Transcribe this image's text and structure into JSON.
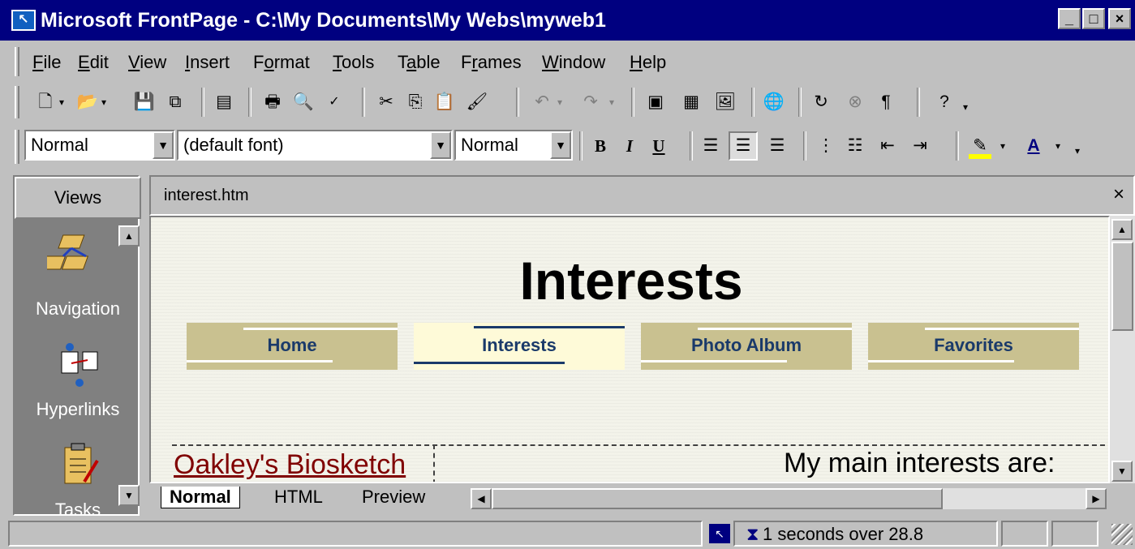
{
  "window": {
    "title": "Microsoft FrontPage - C:\\My Documents\\My Webs\\myweb1",
    "minimize_label": "_",
    "maximize_label": "□",
    "close_label": "×"
  },
  "menu": [
    {
      "pre": "",
      "u": "F",
      "post": "ile"
    },
    {
      "pre": "",
      "u": "E",
      "post": "dit"
    },
    {
      "pre": "",
      "u": "V",
      "post": "iew"
    },
    {
      "pre": "",
      "u": "I",
      "post": "nsert"
    },
    {
      "pre": "F",
      "u": "o",
      "post": "rmat"
    },
    {
      "pre": "",
      "u": "T",
      "post": "ools"
    },
    {
      "pre": "T",
      "u": "a",
      "post": "ble"
    },
    {
      "pre": "F",
      "u": "r",
      "post": "ames"
    },
    {
      "pre": "",
      "u": "W",
      "post": "indow"
    },
    {
      "pre": "",
      "u": "H",
      "post": "elp"
    }
  ],
  "format_bar": {
    "style_value": "Normal",
    "font_value": "(default font)",
    "size_value": "Normal",
    "bold": "B",
    "italic": "I",
    "underline": "U",
    "font_color_letter": "A",
    "highlight_color": "#ffff00",
    "font_color": "#000000"
  },
  "views": {
    "header": "Views",
    "items": [
      {
        "label": "Navigation",
        "icon": "navigation-icon"
      },
      {
        "label": "Hyperlinks",
        "icon": "hyperlinks-icon"
      },
      {
        "label": "Tasks",
        "icon": "tasks-icon"
      }
    ]
  },
  "document": {
    "tab_title": "interest.htm",
    "close_label": "×",
    "heading": "Interests",
    "nav": [
      {
        "label": "Home",
        "selected": false
      },
      {
        "label": "Interests",
        "selected": true
      },
      {
        "label": "Photo Album",
        "selected": false
      },
      {
        "label": "Favorites",
        "selected": false
      }
    ],
    "link_text": "Oakley's Biosketch",
    "body_text": "My main interests are:",
    "view_tabs": [
      "Normal",
      "HTML",
      "Preview"
    ],
    "link_color": "#800000",
    "nav_text_color": "#1a3a6a"
  },
  "status": {
    "download_time": "1 seconds over 28.8"
  },
  "colors": {
    "titlebar": "#000080",
    "chrome": "#c0c0c0",
    "views_panel": "#808080"
  }
}
